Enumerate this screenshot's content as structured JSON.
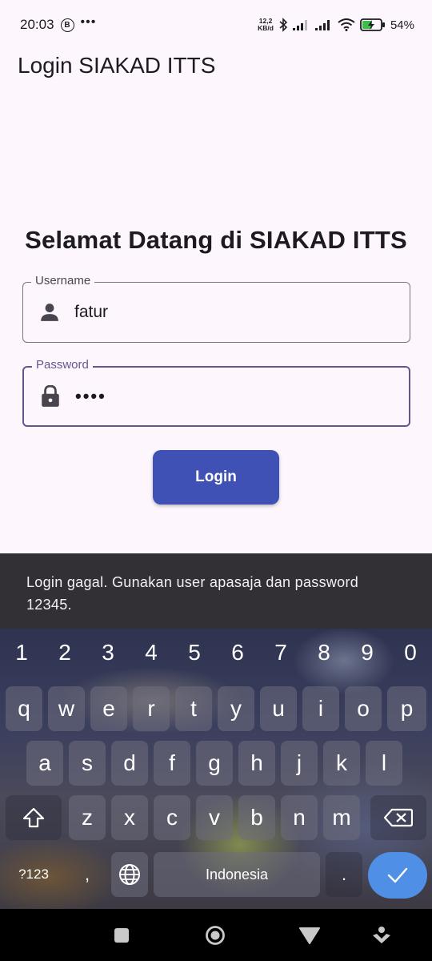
{
  "status_bar": {
    "time": "20:03",
    "b_badge": "B",
    "dots": "•••",
    "speed_top": "12,2",
    "speed_bottom": "KB/d",
    "battery_percent": "54%"
  },
  "app_bar": {
    "title": "Login SIAKAD ITTS"
  },
  "welcome": "Selamat Datang di SIAKAD ITTS",
  "username": {
    "label": "Username",
    "value": "fatur",
    "icon": "person-icon"
  },
  "password": {
    "label": "Password",
    "value": "••••",
    "icon": "lock-icon"
  },
  "login_button": "Login",
  "snackbar": "Login gagal. Gunakan user apasaja dan password 12345.",
  "keyboard": {
    "numbers": [
      "1",
      "2",
      "3",
      "4",
      "5",
      "6",
      "7",
      "8",
      "9",
      "0"
    ],
    "row1": [
      "q",
      "w",
      "e",
      "r",
      "t",
      "y",
      "u",
      "i",
      "o",
      "p"
    ],
    "row2": [
      "a",
      "s",
      "d",
      "f",
      "g",
      "h",
      "j",
      "k",
      "l"
    ],
    "row3": [
      "z",
      "x",
      "c",
      "v",
      "b",
      "n",
      "m"
    ],
    "symbols_key": "?123",
    "comma_key": ",",
    "space_label": "Indonesia",
    "period_key": "."
  },
  "colors": {
    "primary": "#3f51b5",
    "focus": "#65558f",
    "snackbar": "#322f35",
    "enter_key": "#4f8fe6"
  }
}
